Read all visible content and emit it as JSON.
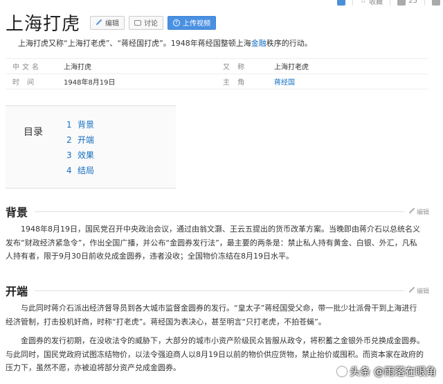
{
  "topbar": {
    "favorite_label": "收藏",
    "like_count": "25"
  },
  "header": {
    "title": "上海打虎",
    "edit_label": "编辑",
    "discuss_label": "讨论",
    "upload_label": "上传视频"
  },
  "summary": {
    "text_before": "上海打虎又称“上海打老虎”、“蒋经国打虎”。1948年蒋经国整顿上海",
    "link": "金融",
    "text_after": "秩序的行动。"
  },
  "infobox": {
    "rows": [
      {
        "label1": "中文名",
        "value1": "上海打虎",
        "label2": "又 称",
        "value2": "上海打老虎"
      },
      {
        "label1": "时 间",
        "value1": "1948年8月19日",
        "label2": "主 角",
        "value2": "蒋经国"
      }
    ]
  },
  "toc": {
    "label": "目录",
    "items": [
      {
        "num": "1",
        "label": "背景"
      },
      {
        "num": "2",
        "label": "开端"
      },
      {
        "num": "3",
        "label": "效果"
      },
      {
        "num": "4",
        "label": "结局"
      }
    ]
  },
  "sections": {
    "edit_label": "编辑",
    "background": {
      "title": "背景",
      "para1": "1948年8月19日，国民党召开中央政治会议，通过由翁文灏、王云五提出的货币改革方案。当晚即由蒋介石以总统名义发布“财政经济紧急令”，作出全国广播，并公布“金圆券发行法”，最主要的两条是：禁止私人持有黄金、白银、外汇，凡私人持有者，限于9月30日前收兑成金圆券，违者没收；全国物价冻结在8月19日水平。"
    },
    "start": {
      "title": "开端",
      "para1": "与此同时蒋介石派出经济督导员到各大城市监督金圆券的发行。“皇太子”蒋经国受父命，带一批少壮派骨干到上海进行经济管制，打击投机奸商，时称“打老虎”。蒋经国为表决心，甚至明言“只打老虎，不拍苍蝇”。",
      "para2": "金圆券的发行初期，在没收法令的威胁下，大部分的城市小资产阶级民众皆服从政令，将积蓄之金银外币兑换成金圆券。与此同时，国民党政府试图冻结物价，以法令强迫商人以8月19日以前的物价供应货物，禁止抬价或囤积。而资本家在政府的压力下，虽然不愿，亦被迫将部分资产兑成金圆券。"
    }
  },
  "watermark": "头条 @雨落在眼角",
  "colors": {
    "link": "#136ec2",
    "upload_button": "#4a90e2"
  }
}
